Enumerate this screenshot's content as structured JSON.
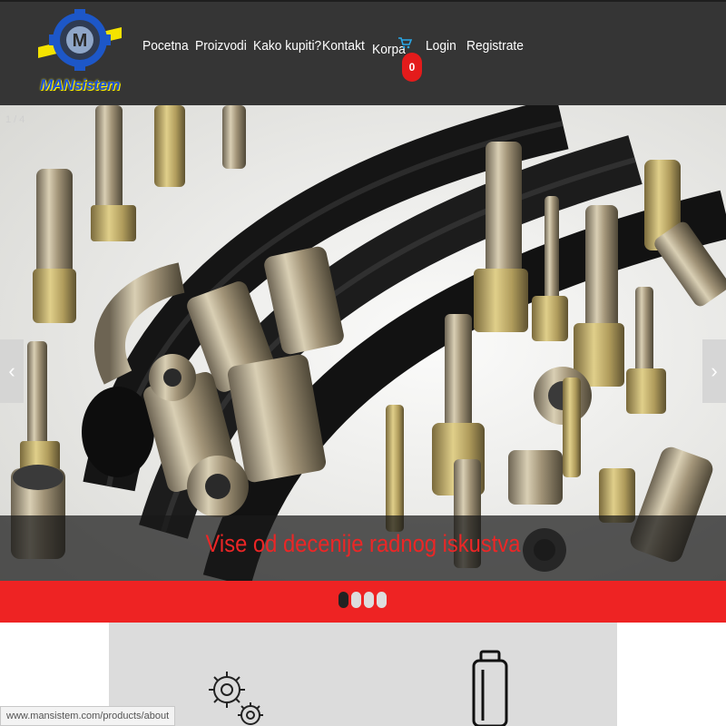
{
  "brand": {
    "logo_text": "MANsistem"
  },
  "nav": {
    "items": [
      {
        "label": "Pocetna"
      },
      {
        "label": "Proizvodi"
      },
      {
        "label": "Kako kupiti?"
      },
      {
        "label": "Kontakt"
      },
      {
        "label": "Korpa"
      },
      {
        "label": "Login"
      },
      {
        "label": "Registrate"
      }
    ],
    "cart_count": "0"
  },
  "slider": {
    "slide_index": "1 / 4",
    "caption": "Vise od decenije radnog iskustva",
    "prev_glyph": "‹",
    "next_glyph": "›",
    "dots": [
      {
        "active": true
      },
      {
        "active": false
      },
      {
        "active": false
      },
      {
        "active": false
      }
    ]
  },
  "colors": {
    "header_bg": "#353535",
    "accent_red": "#ee2323",
    "caption_red": "#ec2626",
    "feature_bg": "#dcdcdc"
  },
  "icons": [
    "cart-icon",
    "gears-icon",
    "oil-can-icon"
  ],
  "status_bar": {
    "url": "www.mansistem.com/products/about"
  }
}
